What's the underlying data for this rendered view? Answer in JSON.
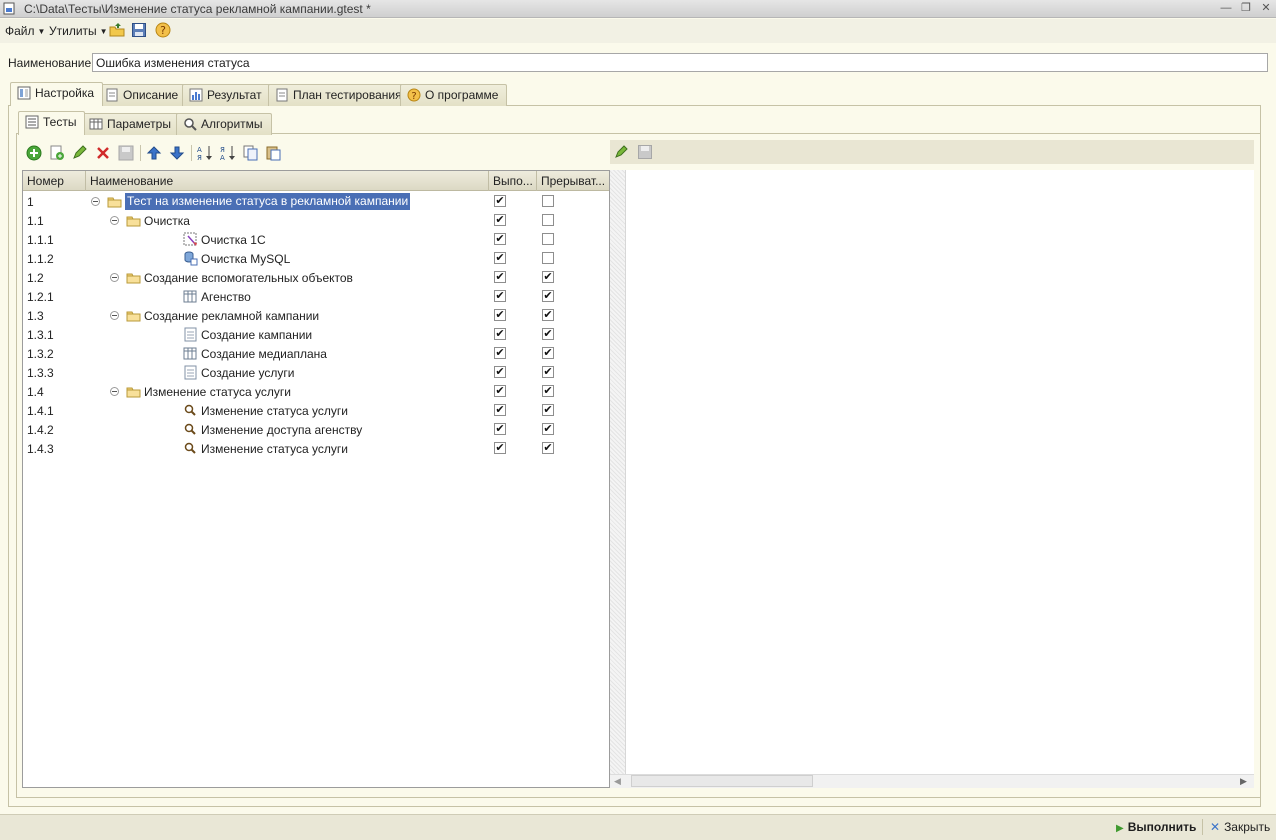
{
  "window": {
    "title": "C:\\Data\\Тесты\\Изменение статуса рекламной кампании.gtest *"
  },
  "menubar": {
    "file": "Файл",
    "utilities": "Утилиты"
  },
  "name_field": {
    "label": "Наименование:",
    "value": "Ошибка изменения статуса"
  },
  "outer_tabs": [
    {
      "label": "Настройка",
      "active": true
    },
    {
      "label": "Описание"
    },
    {
      "label": "Результат"
    },
    {
      "label": "План тестирования"
    },
    {
      "label": "О программе"
    }
  ],
  "inner_tabs": [
    {
      "label": "Тесты",
      "active": true
    },
    {
      "label": "Параметры"
    },
    {
      "label": "Алгоритмы"
    }
  ],
  "grid": {
    "columns": [
      "Номер",
      "Наименование",
      "Выпо...",
      "Прерыват..."
    ],
    "rows": [
      {
        "num": "1",
        "name": "Тест на изменение статуса в рекламной кампании",
        "icon": "folder-icon",
        "run": true,
        "interrupt": false
      },
      {
        "num": "1.1",
        "name": "Очистка",
        "icon": "folder-icon",
        "run": true,
        "interrupt": false
      },
      {
        "num": "1.1.1",
        "name": "Очистка 1С",
        "icon": "cleanup-icon",
        "run": true,
        "interrupt": false
      },
      {
        "num": "1.1.2",
        "name": "Очистка MySQL",
        "icon": "database-icon",
        "run": true,
        "interrupt": false
      },
      {
        "num": "1.2",
        "name": "Создание вспомогательных объектов",
        "icon": "folder-icon",
        "run": true,
        "interrupt": true
      },
      {
        "num": "1.2.1",
        "name": "Агенство",
        "icon": "catalog-icon",
        "run": true,
        "interrupt": true
      },
      {
        "num": "1.3",
        "name": "Создание рекламной кампании",
        "icon": "folder-icon",
        "run": true,
        "interrupt": true
      },
      {
        "num": "1.3.1",
        "name": "Создание кампании",
        "icon": "document-icon",
        "run": true,
        "interrupt": true
      },
      {
        "num": "1.3.2",
        "name": "Создание медиаплана",
        "icon": "catalog-icon",
        "run": true,
        "interrupt": true
      },
      {
        "num": "1.3.3",
        "name": "Создание услуги",
        "icon": "document-icon",
        "run": true,
        "interrupt": true
      },
      {
        "num": "1.4",
        "name": "Изменение статуса услуги",
        "icon": "folder-icon",
        "run": true,
        "interrupt": true
      },
      {
        "num": "1.4.1",
        "name": "Изменение статуса услуги",
        "icon": "search-icon",
        "run": true,
        "interrupt": true
      },
      {
        "num": "1.4.2",
        "name": "Изменение доступа агенству",
        "icon": "search-icon",
        "run": true,
        "interrupt": true
      },
      {
        "num": "1.4.3",
        "name": "Изменение статуса услуги",
        "icon": "search-icon",
        "run": true,
        "interrupt": true
      }
    ]
  },
  "statusbar": {
    "run": "Выполнить",
    "close": "Закрыть"
  },
  "colors": {
    "background": "#fbfaeb",
    "selection": "#4a6fb5",
    "add_green": "#3f9a2f",
    "delete_red": "#d02a2a",
    "arrow_blue": "#3b73c9"
  }
}
